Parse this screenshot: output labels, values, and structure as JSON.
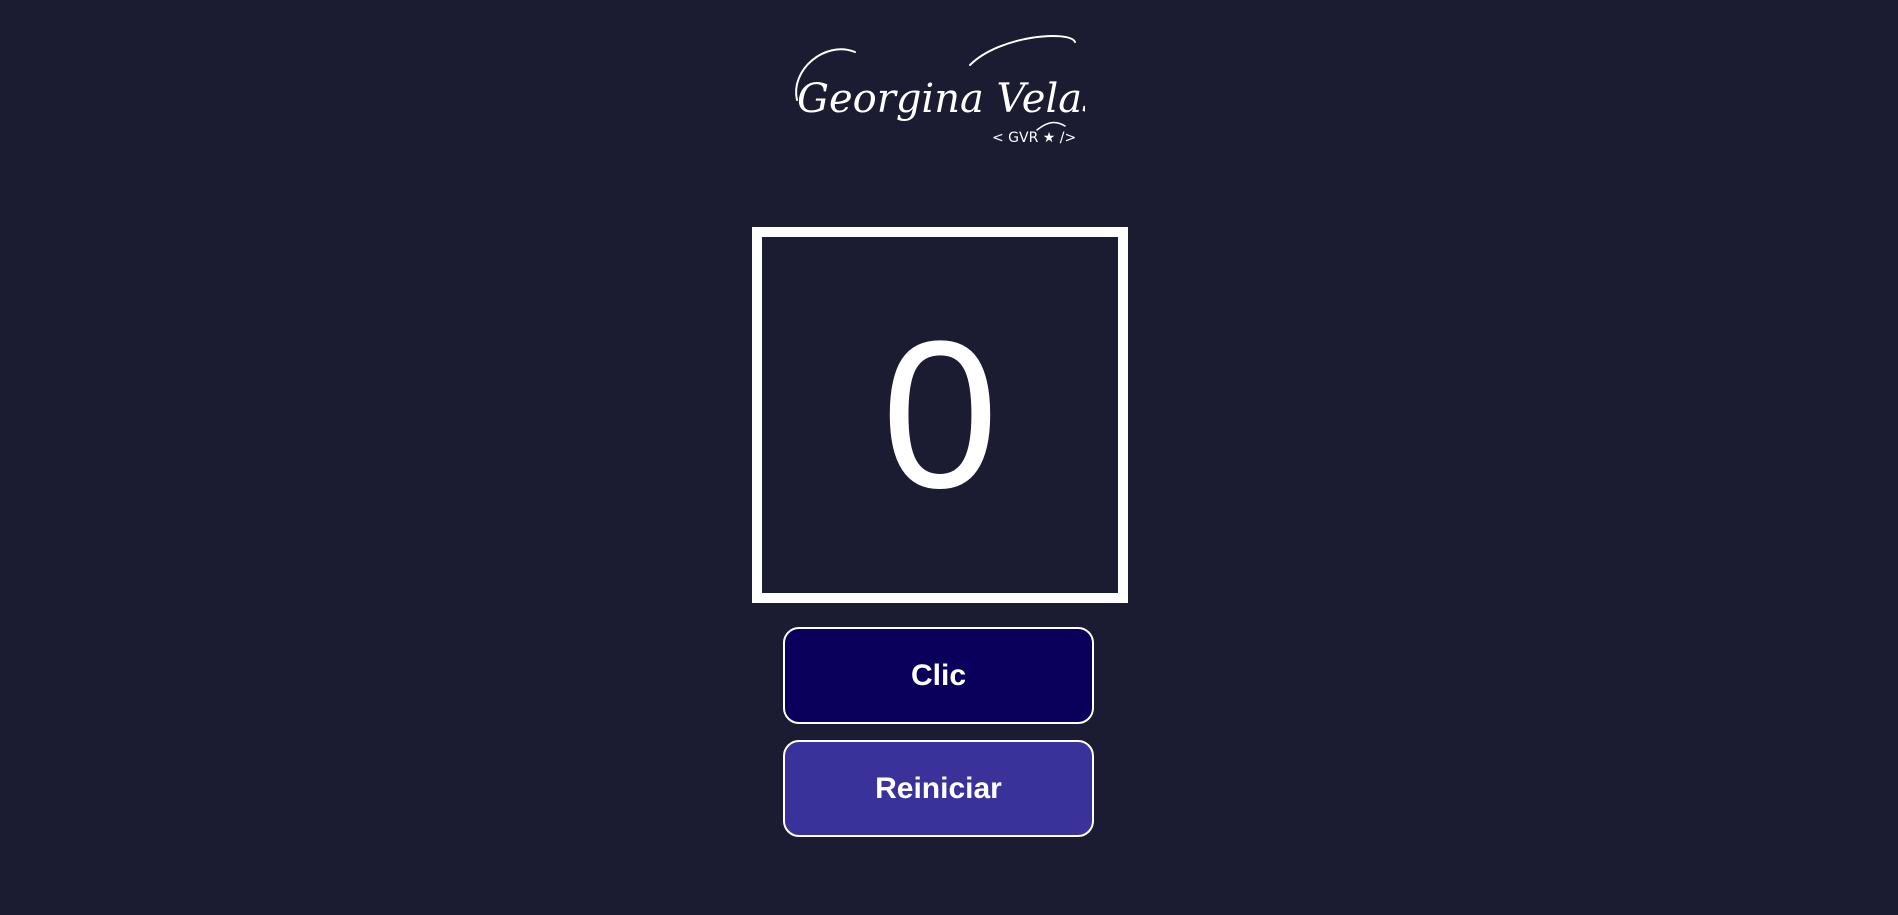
{
  "logo": {
    "signature": "Georgina Velasco",
    "tagline": "< GVR ★ />"
  },
  "counter": {
    "value": "0"
  },
  "buttons": {
    "click_label": "Clic",
    "reset_label": "Reiniciar"
  },
  "colors": {
    "background": "#1b1b31",
    "click_button": "#0a005c",
    "reset_button": "#3a329b",
    "foreground": "#ffffff"
  }
}
